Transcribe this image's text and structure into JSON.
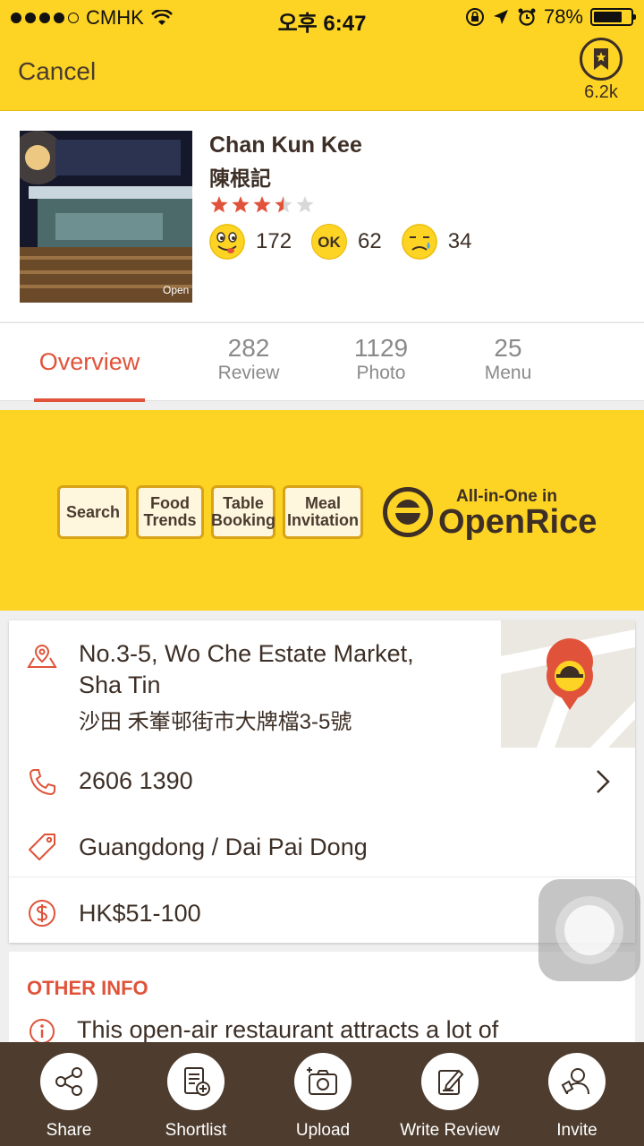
{
  "status": {
    "carrier": "CMHK",
    "time": "오후 6:47",
    "battery": "78%",
    "battery_level": 0.78
  },
  "header": {
    "cancel": "Cancel",
    "bookmark_count": "6.2k"
  },
  "restaurant": {
    "name_en": "Chan Kun Kee",
    "name_zh": "陳根記",
    "rating": 3.5,
    "smile_count": "172",
    "ok_label": "OK",
    "ok_count": "62",
    "cry_count": "34",
    "photo_watermark": "Open"
  },
  "tabs": [
    {
      "label": "Overview",
      "count": ""
    },
    {
      "label": "Review",
      "count": "282"
    },
    {
      "label": "Photo",
      "count": "1129"
    },
    {
      "label": "Menu",
      "count": "25"
    }
  ],
  "banner": {
    "search": "Search",
    "food_trends": "Food Trends",
    "table_booking": "Table Booking",
    "meal_invitation": "Meal Invitation",
    "all_in_one": "All-in-One in",
    "brand": "OpenRice"
  },
  "info": {
    "address_line1": "No.3-5, Wo Che Estate Market,",
    "address_line2": "Sha Tin",
    "address_zh": "沙田 禾輋邨街市大牌檔3-5號",
    "phone": "2606 1390",
    "cuisine": "Guangdong / Dai Pai Dong",
    "price": "HK$51-100"
  },
  "other_info": {
    "title": "OTHER INFO",
    "text": "This open-air restaurant attracts a lot of"
  },
  "bottom_bar": {
    "share": "Share",
    "shortlist": "Shortlist",
    "upload": "Upload",
    "write_review": "Write Review",
    "invite": "Invite"
  },
  "colors": {
    "brand_yellow": "#fdd324",
    "accent_red": "#e0533a",
    "dark_brown": "#4e3d2f"
  }
}
